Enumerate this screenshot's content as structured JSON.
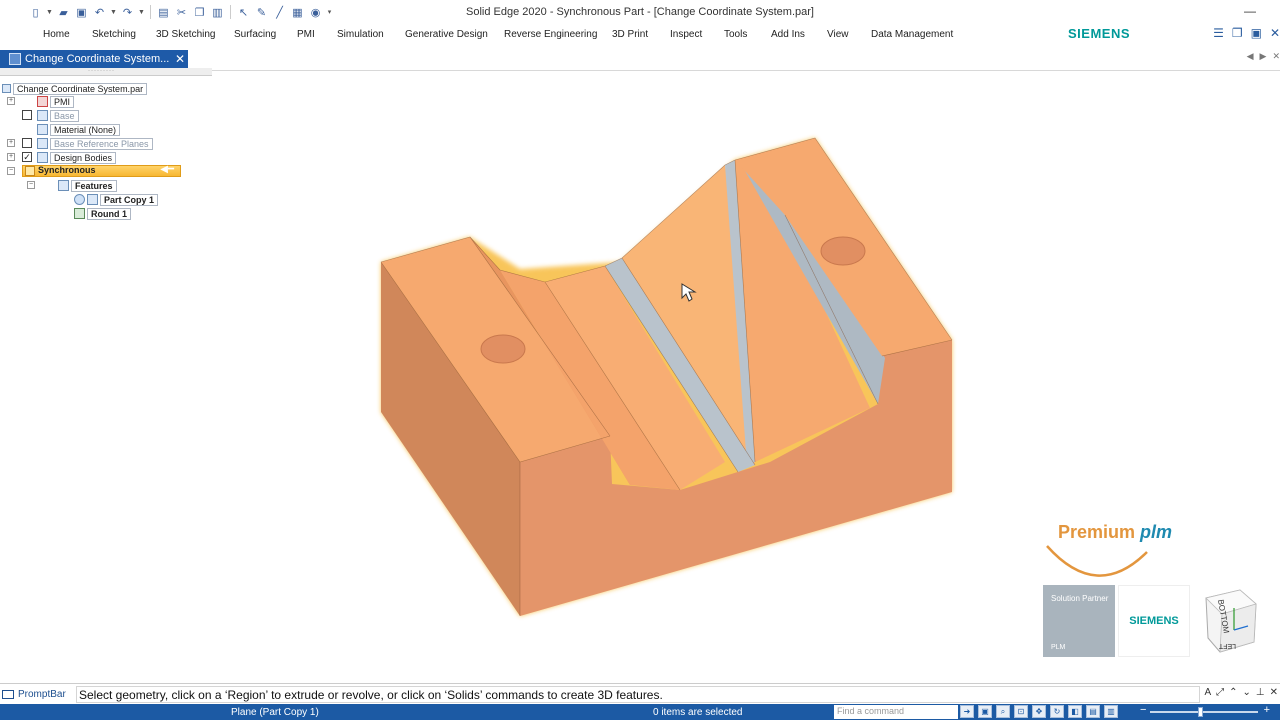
{
  "window": {
    "title": "Solid Edge 2020 - Synchronous Part - [Change Coordinate System.par]",
    "minimize_glyph": "—"
  },
  "quick_access": {
    "icons": [
      "new-icon",
      "open-icon",
      "save-icon",
      "undo-icon",
      "redo-icon",
      "print-icon"
    ]
  },
  "ribbon": {
    "tabs": [
      "Home",
      "Sketching",
      "3D Sketching",
      "Surfacing",
      "PMI",
      "Simulation",
      "Generative Design",
      "Reverse Engineering",
      "3D Print",
      "Inspect",
      "Tools",
      "Add Ins",
      "View",
      "Data Management"
    ],
    "brand": "SIEMENS"
  },
  "pathfinder": {
    "tab_title": "Change Coordinate System...",
    "close_glyph": "✕",
    "root": "Change Coordinate System.par",
    "items": {
      "pmi": "PMI",
      "base": "Base",
      "material": "Material (None)",
      "base_ref_planes": "Base Reference Planes",
      "design_bodies": "Design Bodies",
      "synchronous": "Synchronous",
      "features": "Features",
      "part_copy": "Part Copy 1",
      "round": "Round 1"
    },
    "expanders": {
      "collapsed": "+",
      "expanded": "−"
    },
    "check_mark": "✓"
  },
  "logo": {
    "premium": "Premium",
    "plm": "plm",
    "solution_partner": "Solution Partner",
    "plm_small": "PLM",
    "siemens": "SIEMENS"
  },
  "view_cube": {
    "bottom": "BOTTOM",
    "left": "LEFT"
  },
  "prompt_bar": {
    "label": "PromptBar",
    "text": "Select geometry, click on a ‘Region’ to extrude or revolve, or click on ‘Solids’ commands to create 3D features."
  },
  "status_bar": {
    "plane": "Plane (Part Copy 1)",
    "items_selected": "0 items are selected",
    "find_placeholder": "Find a command",
    "zoom_minus": "−",
    "zoom_plus": "+"
  },
  "colors": {
    "accent": "#1c5aa4",
    "part_face": "#f6a96f",
    "part_side": "#d98657",
    "part_front": "#e4956a",
    "round_face": "#b9c3cc",
    "highlight": "#f7b733"
  }
}
